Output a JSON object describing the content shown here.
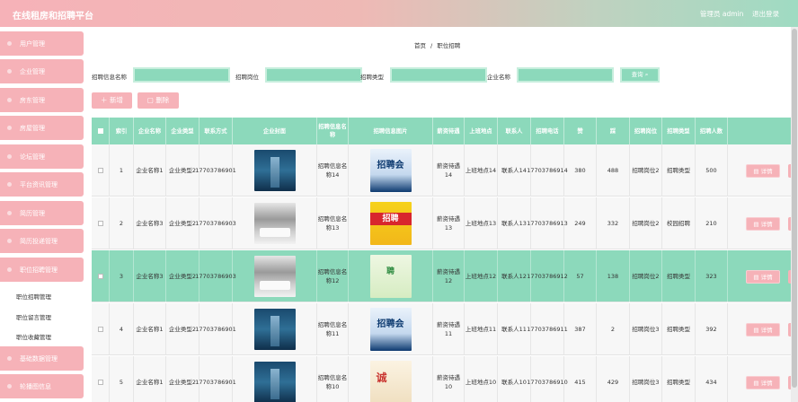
{
  "header": {
    "title": "在线租房和招聘平台",
    "user": "管理员 admin",
    "logout": "退出登录"
  },
  "sidebar": {
    "menus": [
      {
        "label": "用户管理"
      },
      {
        "label": "企业管理"
      },
      {
        "label": "房东管理"
      },
      {
        "label": "房屋管理"
      },
      {
        "label": "论坛管理"
      },
      {
        "label": "平台资讯管理"
      },
      {
        "label": "简历管理"
      },
      {
        "label": "简历投递管理"
      },
      {
        "label": "职位招聘管理"
      },
      {
        "label": "基础数据管理"
      },
      {
        "label": "轮播图信息"
      }
    ],
    "submenu": [
      "职位招聘管理",
      "职位留言管理",
      "职位收藏管理"
    ]
  },
  "breadcrumb": {
    "home": "首页",
    "sep": "/",
    "current": "职位招聘"
  },
  "filters": {
    "f1_label": "招聘信息名称",
    "f2_label": "招聘岗位",
    "f3_label": "招聘类型",
    "f4_label": "企业名称",
    "search_label": "查询"
  },
  "actions": {
    "add": "新增",
    "delete": "删除"
  },
  "table": {
    "headers": [
      "",
      "索引",
      "企业名称",
      "企业类型",
      "联系方式",
      "企业封面",
      "招聘信息名称",
      "招聘信息图片",
      "薪资待遇",
      "上班地点",
      "联系人",
      "招聘电话",
      "赞",
      "踩",
      "招聘岗位",
      "招聘类型",
      "招聘人数",
      ""
    ],
    "detail_label": "详情",
    "rows": [
      {
        "idx": "1",
        "company": "企业名称1",
        "ctype": "企业类型2",
        "contact": "17703786901",
        "cover": "cover1",
        "name": "招聘信息名称14",
        "poster": "p14",
        "poster_text": "招聘会",
        "salary": "薪资待遇14",
        "place": "上班地点14",
        "person": "联系人14",
        "phone": "17703786914",
        "up": "380",
        "down": "488",
        "post": "招聘岗位2",
        "rtype": "招聘类型",
        "num": "500"
      },
      {
        "idx": "2",
        "company": "企业名称3",
        "ctype": "企业类型2",
        "contact": "17703786903",
        "cover": "cover3",
        "name": "招聘信息名称13",
        "poster": "p13",
        "poster_text": "招聘",
        "salary": "薪资待遇13",
        "place": "上班地点13",
        "person": "联系人13",
        "phone": "17703786913",
        "up": "249",
        "down": "332",
        "post": "招聘岗位2",
        "rtype": "校园招聘",
        "num": "210"
      },
      {
        "idx": "3",
        "company": "企业名称3",
        "ctype": "企业类型2",
        "contact": "17703786903",
        "cover": "cover3",
        "name": "招聘信息名称12",
        "poster": "p12",
        "poster_text": "聘",
        "salary": "薪资待遇12",
        "place": "上班地点12",
        "person": "联系人12",
        "phone": "17703786912",
        "up": "57",
        "down": "138",
        "post": "招聘岗位2",
        "rtype": "招聘类型",
        "num": "323"
      },
      {
        "idx": "4",
        "company": "企业名称1",
        "ctype": "企业类型2",
        "contact": "17703786901",
        "cover": "cover1",
        "name": "招聘信息名称11",
        "poster": "p11",
        "poster_text": "招聘会",
        "salary": "薪资待遇11",
        "place": "上班地点11",
        "person": "联系人11",
        "phone": "17703786911",
        "up": "387",
        "down": "2",
        "post": "招聘岗位3",
        "rtype": "招聘类型",
        "num": "392"
      },
      {
        "idx": "5",
        "company": "企业名称1",
        "ctype": "企业类型2",
        "contact": "17703786901",
        "cover": "cover1",
        "name": "招聘信息名称10",
        "poster": "p10",
        "poster_text": "诚",
        "salary": "薪资待遇10",
        "place": "上班地点10",
        "person": "联系人10",
        "phone": "17703786910",
        "up": "415",
        "down": "429",
        "post": "招聘岗位3",
        "rtype": "招聘类型",
        "num": "434"
      }
    ]
  },
  "colors": {
    "pink": "#f6b2b8",
    "mint": "#8cd9bb"
  }
}
